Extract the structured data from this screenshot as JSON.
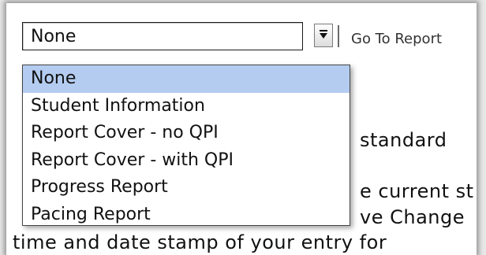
{
  "select": {
    "value": "None",
    "options": [
      {
        "label": "None",
        "selected": true
      },
      {
        "label": "Student Information",
        "selected": false
      },
      {
        "label": "Report Cover - no QPI",
        "selected": false
      },
      {
        "label": "Report Cover - with QPI",
        "selected": false
      },
      {
        "label": "Progress Report",
        "selected": false
      },
      {
        "label": "Pacing Report",
        "selected": false
      }
    ]
  },
  "goto_label": "Go To Report",
  "background_text": {
    "line1": "standard",
    "line2": "e current st",
    "line3": "ve Change",
    "line4": "time and date stamp of your entry for"
  },
  "colors": {
    "selected_option": "#b4ccf0"
  }
}
